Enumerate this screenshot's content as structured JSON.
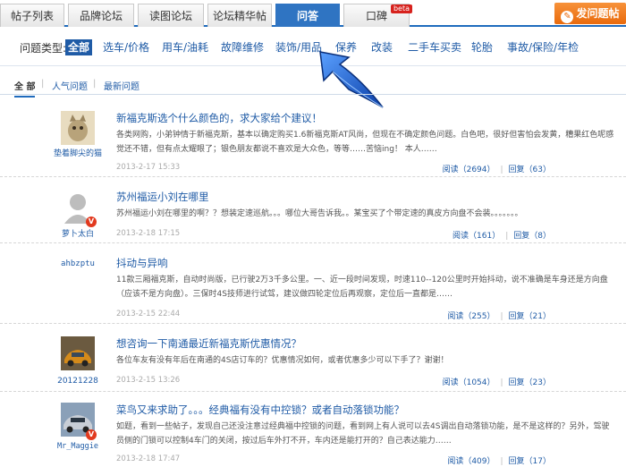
{
  "tabs": [
    {
      "label": "帖子列表"
    },
    {
      "label": "品牌论坛"
    },
    {
      "label": "读图论坛"
    },
    {
      "label": "论坛精华帖"
    },
    {
      "label": "问答"
    },
    {
      "label": "口碑"
    }
  ],
  "beta_label": "beta",
  "post_button": {
    "label": "发问题帖",
    "icon": "pencil-icon"
  },
  "categories": {
    "label": "问题类型:",
    "items": [
      "全部",
      "选车/价格",
      "用车/油耗",
      "故障维修",
      "装饰/用品",
      "保养",
      "改装",
      "二手车买卖",
      "轮胎",
      "事故/保险/年检"
    ]
  },
  "subtabs": [
    "全 部",
    "人气问题",
    "最新问题"
  ],
  "posts": [
    {
      "user": "垫着脚尖的猫",
      "title": "新福克斯选个什么颜色的，求大家给个建议！",
      "body": "各类网购，小弟钟情于新福克斯，基本以确定购买1.6新福克斯AT风尚，但现在不确定颜色问题。白色吧，很好但害怕会发黄，糟果红色呢感觉还不错，但有点太耀眼了；银色朋友都说不喜欢是大众色，等等……苦恼ing！ 本人……",
      "date": "2013-2-17 15:33",
      "reads": "阅读（2694）",
      "replies": "回复（63）"
    },
    {
      "user": "萝卜太白",
      "title": "苏州福运小刘在哪里",
      "body": "苏州福运小刘在哪里的啊？？想装定速巡航。。。哪位大哥告诉我。。某宝买了个带定速的真皮方向盘不会装。。。。。。。",
      "date": "2013-2-18 17:15",
      "reads": "阅读（161）",
      "replies": "回复（8）"
    },
    {
      "user": "ahbzptu",
      "title": "抖动与异响",
      "body": "11款三厢福克斯，自动时尚版，已行驶2万3千多公里。一、近一段时间发现，时速110--120公里时开始抖动，说不准确是车身还是方向盘（应该不是方向盘）。三保时4S技师进行试驾，建议做四轮定位后再观察，定位后一直都是……",
      "date": "2013-2-15 22:44",
      "reads": "阅读（255）",
      "replies": "回复（21）"
    },
    {
      "user": "20121228",
      "title": "想咨询一下南通最近新福克斯优惠情况？",
      "body": "各位车友有没有年后在南通的4S店订车的？优惠情况如何，或者优惠多少可以下手了？谢谢！",
      "date": "2013-2-15 13:26",
      "reads": "阅读（1054）",
      "replies": "回复（23）"
    },
    {
      "user": "Mr_Maggie",
      "title": "菜鸟又来求助了。。。经典福有没有中控锁？或者自动落锁功能？",
      "body": "如题，看到一些帖子，发现自己还没注意过经典福中控锁的问题，看到网上有人说可以去4S调出自动落锁功能，是不是这样的？另外，驾驶员侧的门锁可以控制4车门的关闭，按过后车外打不开，车内还是能打开的？自己表达能力……",
      "date": "2013-2-18 17:47",
      "reads": "阅读（409）",
      "replies": "回复（17）"
    }
  ],
  "colors": {
    "accent": "#1f6bbd",
    "link": "#1f5ba6",
    "post_button": "#e96a0c",
    "arrow": "#1e5fd0"
  }
}
